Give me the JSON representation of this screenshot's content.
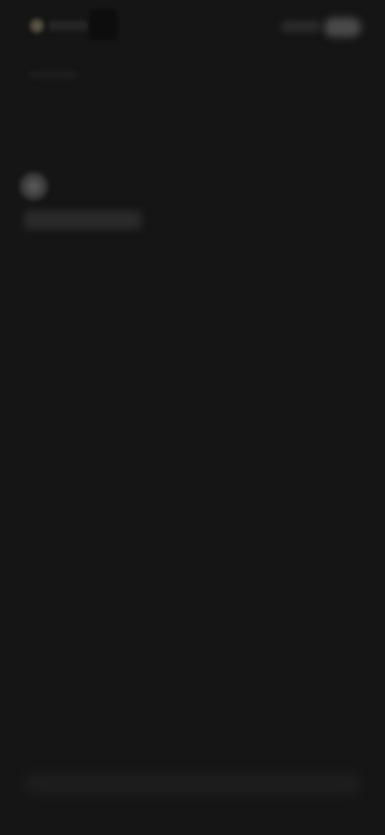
{
  "app": {
    "theme_bg": "#151515"
  },
  "header": {
    "logo_icon": "app-logo-icon",
    "action_icon": "menu-pill-icon"
  },
  "profile": {
    "avatar_icon": "avatar-icon"
  },
  "footer": {
    "bar_icon": "bottom-input-bar"
  }
}
